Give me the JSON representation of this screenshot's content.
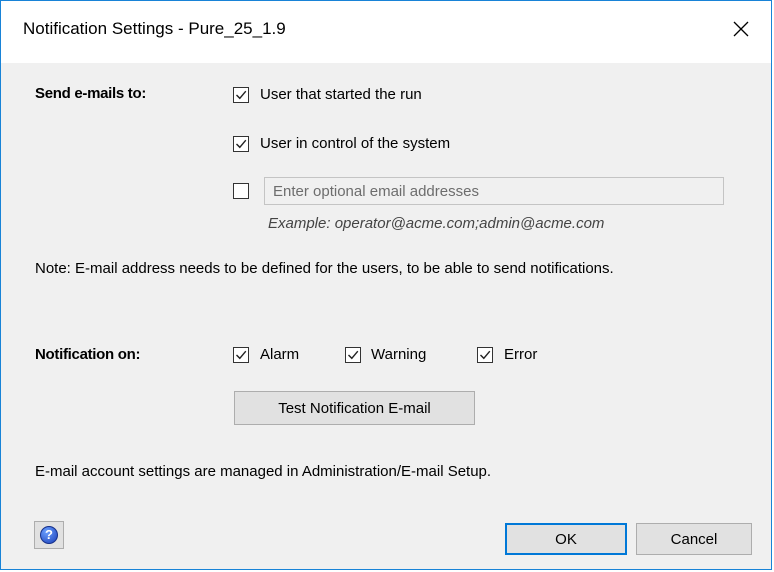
{
  "dialog": {
    "title": "Notification Settings - Pure_25_1.9"
  },
  "send": {
    "label": "Send e-mails to:",
    "user_started": {
      "label": "User that started the run",
      "checked": true
    },
    "user_control": {
      "label": "User in control of the system",
      "checked": true
    },
    "optional": {
      "checked": false,
      "placeholder": "Enter optional email addresses",
      "value": ""
    },
    "example": "Example: operator@acme.com;admin@acme.com"
  },
  "note": "Note: E-mail address needs to be defined for the users, to be able to send notifications.",
  "notify": {
    "label": "Notification on:",
    "alarm": {
      "label": "Alarm",
      "checked": true
    },
    "warning": {
      "label": "Warning",
      "checked": true
    },
    "error": {
      "label": "Error",
      "checked": true
    }
  },
  "test_button": "Test Notification E-mail",
  "account_note": "E-mail account settings are managed in Administration/E-mail Setup.",
  "buttons": {
    "ok": "OK",
    "cancel": "Cancel"
  },
  "icons": {
    "close": "close-icon",
    "help": "help-icon",
    "check": "checkmark-icon"
  },
  "colors": {
    "accent": "#0078d7",
    "dialog_bg": "#f0f0f0",
    "button_bg": "#e1e1e1"
  }
}
